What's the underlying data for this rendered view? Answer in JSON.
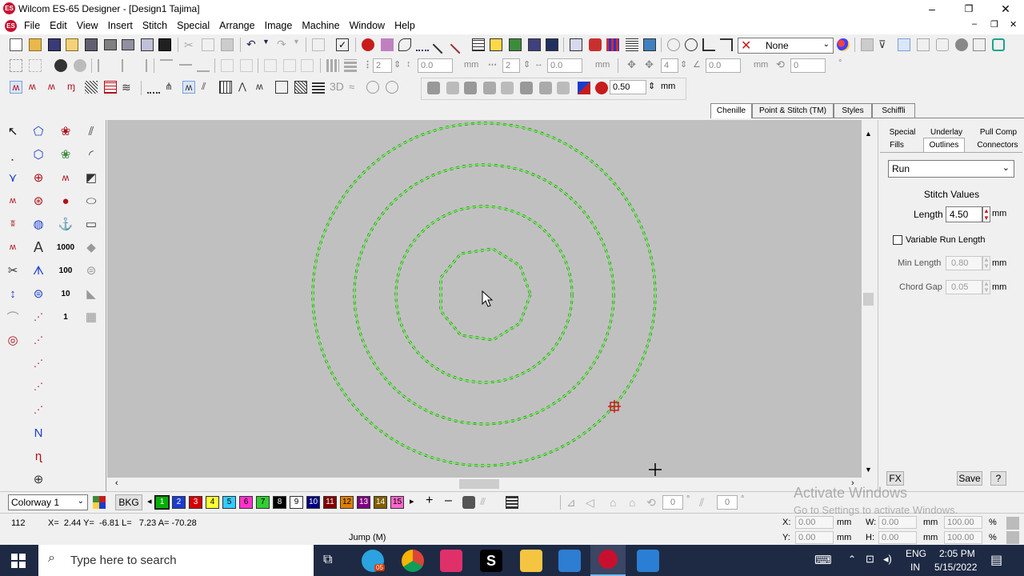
{
  "window": {
    "app_icon_text": "ES",
    "title": "Wilcom ES-65 Designer - [Design1        Tajima]",
    "minimize": "–",
    "maximize": "❐",
    "close": "✕"
  },
  "menu": {
    "items": [
      "File",
      "Edit",
      "View",
      "Insert",
      "Stitch",
      "Special",
      "Arrange",
      "Image",
      "Machine",
      "Window",
      "Help"
    ],
    "mdi_controls": [
      "–",
      "❐",
      "✕"
    ]
  },
  "toolbar1": {
    "color_select": "None"
  },
  "toolbar2": {
    "spin1": "2",
    "spin2": "0.0",
    "unit1": "mm",
    "spin3": "2",
    "spin4": "0.0",
    "unit2": "mm",
    "spin5": "4",
    "spin6": "0.0",
    "unit3": "mm",
    "spin7": "0"
  },
  "toolbar3": {
    "label_3d": "3D",
    "length_value": "0.50",
    "length_unit": "mm"
  },
  "stitch_tabs": [
    "Chenille",
    "Point & Stitch (TM)",
    "Styles",
    "Schiffli"
  ],
  "panel": {
    "tabs_row1": [
      "Special",
      "Underlay",
      "Pull Comp"
    ],
    "tabs_row2": [
      "Fills",
      "Outlines",
      "Connectors"
    ],
    "active_tab": "Outlines",
    "type_select": "Run",
    "stitch_values_heading": "Stitch Values",
    "length_label": "Length",
    "length_value": "4.50",
    "length_unit": "mm",
    "variable_run_label": "Variable Run Length",
    "variable_run_checked": false,
    "min_length_label": "Min Length",
    "min_length_value": "0.80",
    "min_length_unit": "mm",
    "chord_gap_label": "Chord Gap",
    "chord_gap_value": "0.05",
    "chord_gap_unit": "mm",
    "fx_button": "FX",
    "save_button": "Save",
    "help_button": "?"
  },
  "colorbar": {
    "colorway": "Colorway 1",
    "bkg": "BKG",
    "swatches": [
      {
        "label": "1",
        "color": "#00b000",
        "text": "#fff"
      },
      {
        "label": "2",
        "color": "#1c3ccf",
        "text": "#fff"
      },
      {
        "label": "3",
        "color": "#d40000",
        "text": "#fff"
      },
      {
        "label": "4",
        "color": "#ffff33",
        "text": "#000"
      },
      {
        "label": "5",
        "color": "#33ccff",
        "text": "#000"
      },
      {
        "label": "6",
        "color": "#ff33cc",
        "text": "#000"
      },
      {
        "label": "7",
        "color": "#33cc33",
        "text": "#000"
      },
      {
        "label": "8",
        "color": "#000000",
        "text": "#fff"
      },
      {
        "label": "9",
        "color": "#ffffff",
        "text": "#000"
      },
      {
        "label": "10",
        "color": "#000080",
        "text": "#fff"
      },
      {
        "label": "11",
        "color": "#800000",
        "text": "#fff"
      },
      {
        "label": "12",
        "color": "#e08000",
        "text": "#000"
      },
      {
        "label": "13",
        "color": "#800080",
        "text": "#fff"
      },
      {
        "label": "14",
        "color": "#806000",
        "text": "#fff"
      },
      {
        "label": "15",
        "color": "#ff66cc",
        "text": "#000"
      }
    ],
    "spin_a": "0",
    "spin_b": "0"
  },
  "status": {
    "stitch_number": "112",
    "coords": "X=  2.44 Y=  -6.81 L=   7.23 A= -70.28",
    "stitch_type": "Jump (M)",
    "x_label": "X:",
    "x_value": "0.00",
    "y_label": "Y:",
    "y_value": "0.00",
    "w_label": "W:",
    "w_value": "0.00",
    "h_label": "H:",
    "h_value": "0.00",
    "unit": "mm",
    "wpct": "100.00",
    "hpct": "100.00",
    "pct": "%"
  },
  "watermark": {
    "title": "Activate Windows",
    "subtitle": "Go to Settings to activate Windows."
  },
  "taskbar": {
    "search_placeholder": "Type here to search",
    "lang": "ENG",
    "region": "IN",
    "time": "2:05 PM",
    "date": "5/15/2022",
    "badge": "05"
  },
  "colors": {
    "stitch_green": "#7ee06a",
    "stitch_dark": "#1d5a1d",
    "canvas": "#c0c0c0",
    "taskbar": "#1e2a44"
  }
}
